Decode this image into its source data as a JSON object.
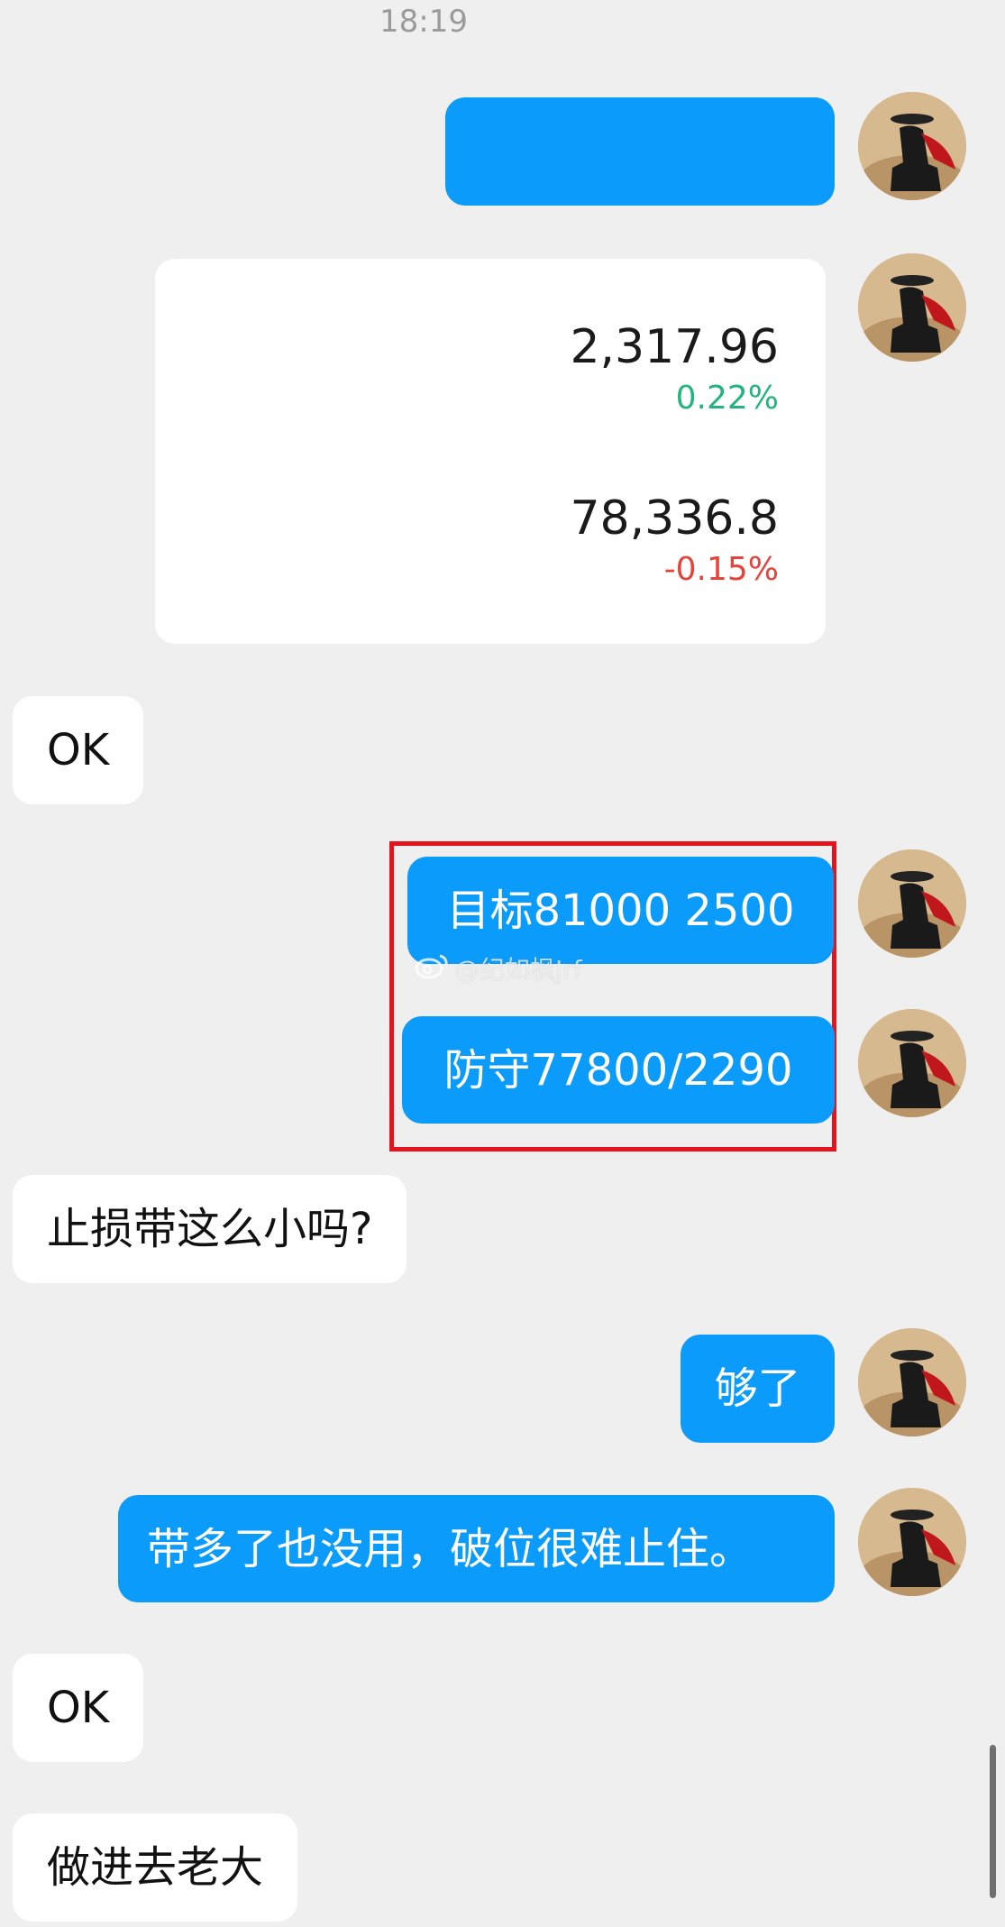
{
  "header": {
    "time": "18:19"
  },
  "messages": {
    "m1_text": "",
    "quotes": [
      {
        "value": "2,317.96",
        "change": "0.22%",
        "change_color": "#24b47e"
      },
      {
        "value": "78,336.8",
        "change": "-0.15%",
        "change_color": "#e5443b"
      }
    ],
    "m3": "OK",
    "m4": "目标81000 2500",
    "m5": "防守77800/2290",
    "m6": "止损带这么小吗?",
    "m7": "够了",
    "m8": "带多了也没用，破位很难止住。",
    "m9": "OK",
    "m10": "做进去老大"
  },
  "watermark": {
    "text": "@纪如枫Jrf"
  },
  "colors": {
    "outgoing_bubble": "#0b9bfa",
    "incoming_bubble": "#ffffff",
    "background": "#efefef",
    "highlight_border": "#e3141b"
  }
}
